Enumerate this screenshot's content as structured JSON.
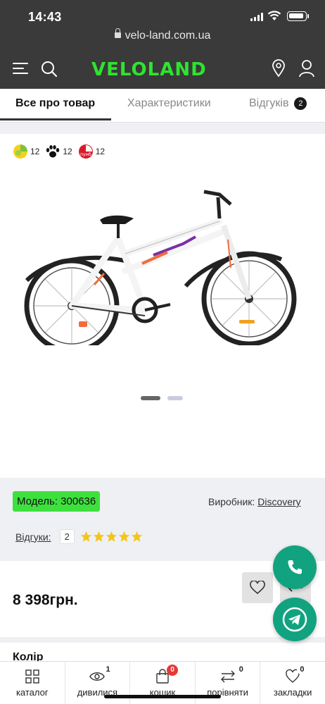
{
  "status_bar": {
    "time": "14:43"
  },
  "browser": {
    "url": "velo-land.com.ua"
  },
  "header": {
    "logo": "VELOLAND",
    "brand_color": "#2fe32f"
  },
  "tabs": [
    {
      "label": "Все про товар",
      "active": true
    },
    {
      "label": "Характеристики",
      "active": false
    },
    {
      "label": "Відгуків",
      "active": false,
      "badge": "2"
    }
  ],
  "promos": [
    {
      "icon": "installment-lime-icon",
      "value": "12"
    },
    {
      "icon": "paw-icon",
      "value": "12"
    },
    {
      "icon": "pumb-icon",
      "value": "12",
      "icon_text": "пумб"
    }
  ],
  "gallery": {
    "slides": 2,
    "active_slide": 1
  },
  "product": {
    "model": "Модель: 300636",
    "maker_label": "Виробник:",
    "maker": "Discovery",
    "reviews_label": "Відгуки:",
    "reviews_count": "2",
    "rating": 5,
    "price": "8 398грн.",
    "color_label": "Колір"
  },
  "bottom_bar": [
    {
      "label": "каталог",
      "icon": "grid-icon",
      "badge": ""
    },
    {
      "label": "дивилися",
      "icon": "eye-icon",
      "badge": "1"
    },
    {
      "label": "кошик",
      "icon": "bag-icon",
      "badge": "0"
    },
    {
      "label": "порівняти",
      "icon": "compare-icon",
      "badge": "0"
    },
    {
      "label": "закладки",
      "icon": "heart-icon",
      "badge": "0"
    }
  ],
  "colors": {
    "accent": "#3ee03e",
    "fab": "#11a37f",
    "star": "#f5c518",
    "cart_badge": "#e53935"
  }
}
